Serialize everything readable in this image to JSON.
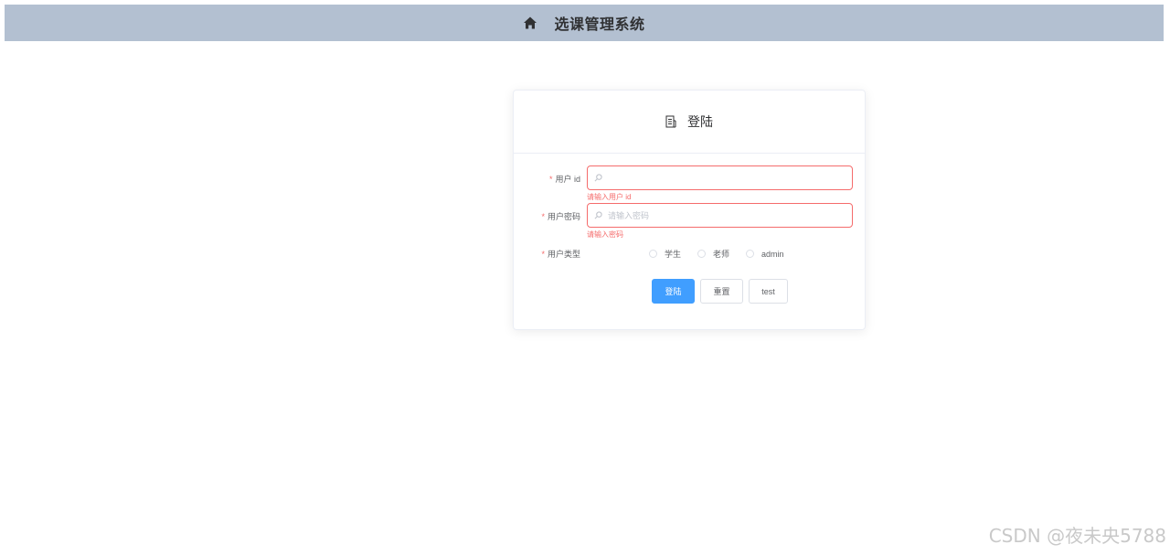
{
  "header": {
    "title": "选课管理系统",
    "icon": "home-icon"
  },
  "login_card": {
    "title": "登陆",
    "icon": "document-icon",
    "fields": {
      "user_id": {
        "label": "用户 id",
        "value": "",
        "placeholder": "",
        "error": "请输入用户 id"
      },
      "password": {
        "label": "用户密码",
        "value": "",
        "placeholder": "请输入密码",
        "error": "请输入密码"
      },
      "user_type": {
        "label": "用户类型",
        "options": [
          "学生",
          "老师",
          "admin"
        ],
        "selected": null
      }
    },
    "required_mark": "*",
    "buttons": {
      "login": "登陆",
      "reset": "重置",
      "test": "test"
    }
  },
  "watermark": "CSDN @夜未央5788",
  "colors": {
    "header_bg": "#b3c0d1",
    "primary": "#409eff",
    "error": "#f56c6c"
  }
}
